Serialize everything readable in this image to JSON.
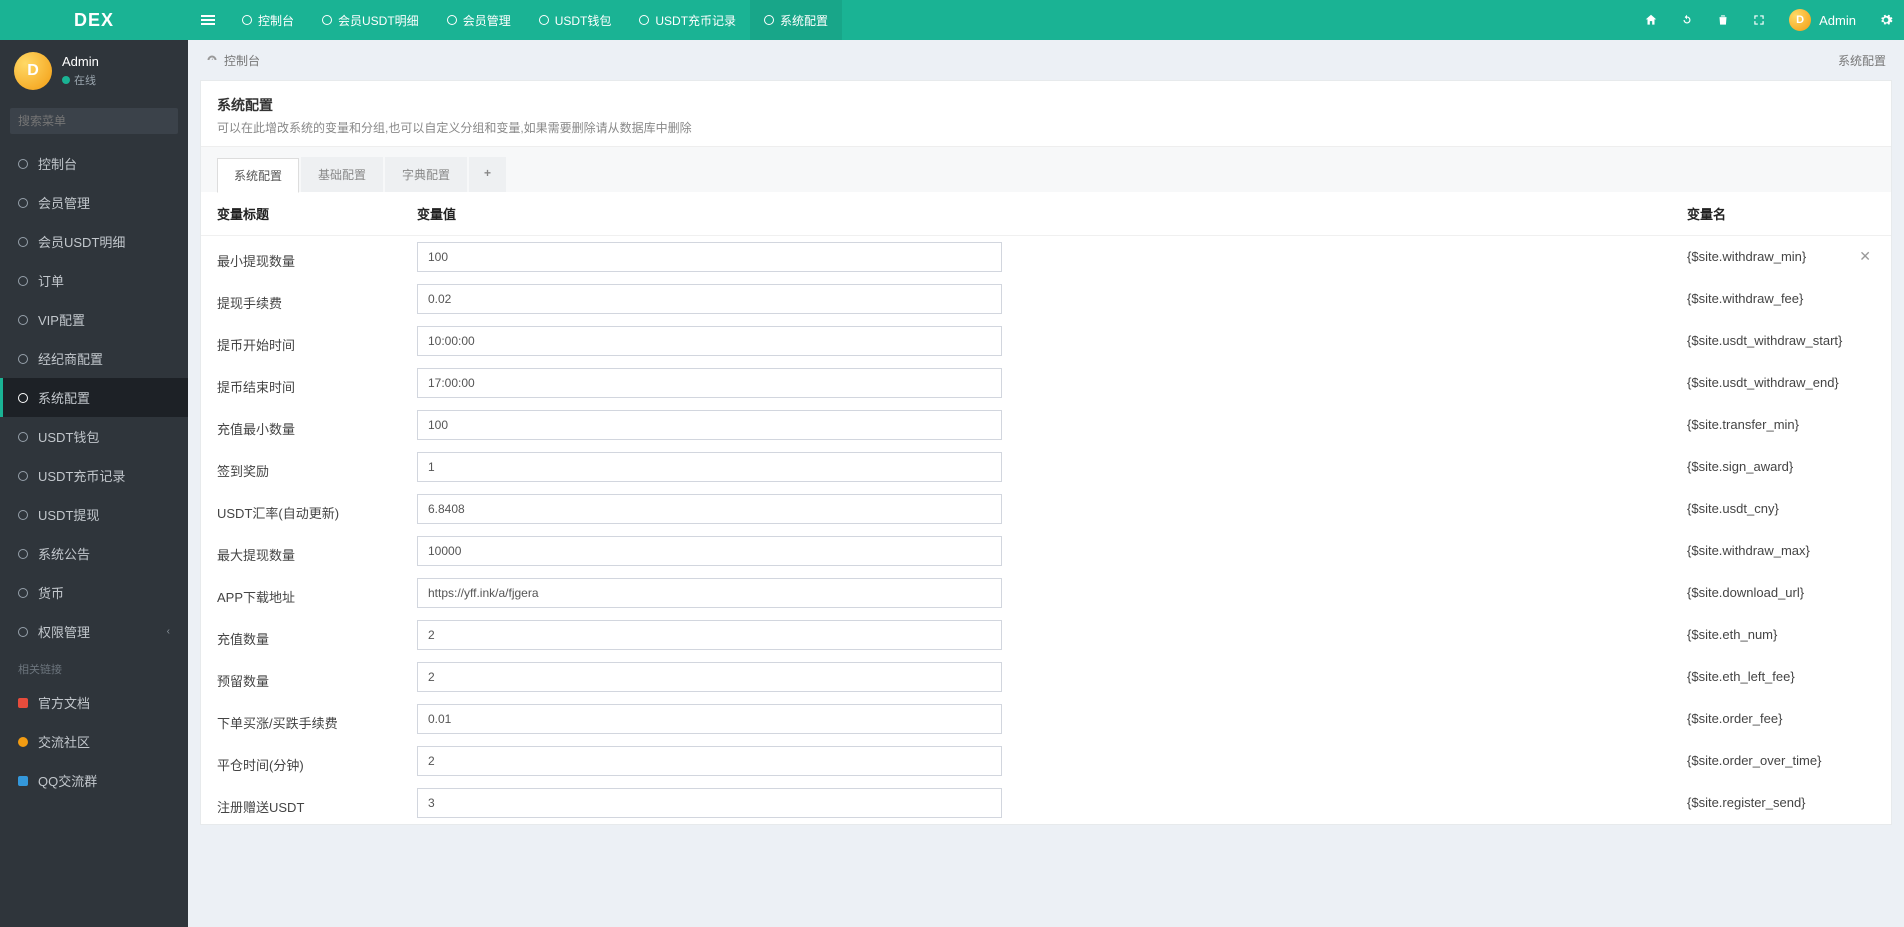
{
  "app": {
    "logo": "DEX"
  },
  "header": {
    "tabs": [
      {
        "label": "控制台",
        "active": false
      },
      {
        "label": "会员USDT明细",
        "active": false
      },
      {
        "label": "会员管理",
        "active": false
      },
      {
        "label": "USDT钱包",
        "active": false
      },
      {
        "label": "USDT充币记录",
        "active": false
      },
      {
        "label": "系统配置",
        "active": true
      }
    ],
    "user": "Admin"
  },
  "sidebar": {
    "user": {
      "name": "Admin",
      "status": "在线"
    },
    "search_placeholder": "搜索菜单",
    "menu": [
      {
        "label": "控制台"
      },
      {
        "label": "会员管理"
      },
      {
        "label": "会员USDT明细"
      },
      {
        "label": "订单"
      },
      {
        "label": "VIP配置"
      },
      {
        "label": "经纪商配置"
      },
      {
        "label": "系统配置",
        "active": true
      },
      {
        "label": "USDT钱包"
      },
      {
        "label": "USDT充币记录"
      },
      {
        "label": "USDT提现"
      },
      {
        "label": "系统公告"
      },
      {
        "label": "货币"
      },
      {
        "label": "权限管理",
        "has_sub": true
      }
    ],
    "links_title": "相关链接",
    "links": [
      {
        "label": "官方文档",
        "cls": "doc"
      },
      {
        "label": "交流社区",
        "cls": "chat"
      },
      {
        "label": "QQ交流群",
        "cls": "qq"
      }
    ]
  },
  "breadcrumb": {
    "home": "控制台",
    "current": "系统配置"
  },
  "panel": {
    "title": "系统配置",
    "desc": "可以在此增改系统的变量和分组,也可以自定义分组和变量,如果需要删除请从数据库中删除",
    "tabs": [
      "系统配置",
      "基础配置",
      "字典配置"
    ],
    "plus": "+",
    "columns": {
      "c1": "变量标题",
      "c2": "变量值",
      "c3": "变量名"
    },
    "rows": [
      {
        "title": "最小提现数量",
        "value": "100",
        "name": "{$site.withdraw_min}",
        "close": true
      },
      {
        "title": "提现手续费",
        "value": "0.02",
        "name": "{$site.withdraw_fee}"
      },
      {
        "title": "提币开始时间",
        "value": "10:00:00",
        "name": "{$site.usdt_withdraw_start}"
      },
      {
        "title": "提币结束时间",
        "value": "17:00:00",
        "name": "{$site.usdt_withdraw_end}"
      },
      {
        "title": "充值最小数量",
        "value": "100",
        "name": "{$site.transfer_min}"
      },
      {
        "title": "签到奖励",
        "value": "1",
        "name": "{$site.sign_award}"
      },
      {
        "title": "USDT汇率(自动更新)",
        "value": "6.8408",
        "name": "{$site.usdt_cny}"
      },
      {
        "title": "最大提现数量",
        "value": "10000",
        "name": "{$site.withdraw_max}"
      },
      {
        "title": "APP下载地址",
        "value": "https://yff.ink/a/fjgera",
        "name": "{$site.download_url}"
      },
      {
        "title": "充值数量",
        "value": "2",
        "name": "{$site.eth_num}"
      },
      {
        "title": "预留数量",
        "value": "2",
        "name": "{$site.eth_left_fee}"
      },
      {
        "title": "下单买涨/买跌手续费",
        "value": "0.01",
        "name": "{$site.order_fee}"
      },
      {
        "title": "平仓时间(分钟)",
        "value": "2",
        "name": "{$site.order_over_time}"
      },
      {
        "title": "注册赠送USDT",
        "value": "3",
        "name": "{$site.register_send}"
      }
    ]
  }
}
